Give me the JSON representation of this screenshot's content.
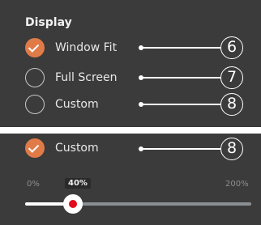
{
  "display": {
    "heading": "Display",
    "options": [
      {
        "label": "Window Fit",
        "selected": true,
        "callout": "6"
      },
      {
        "label": "Full Screen",
        "selected": false,
        "callout": "7"
      },
      {
        "label": "Custom",
        "selected": false,
        "callout": "8"
      }
    ]
  },
  "custom_detail": {
    "option": {
      "label": "Custom",
      "selected": true,
      "callout": "8"
    },
    "slider": {
      "min_label": "0%",
      "max_label": "200%",
      "value_label": "40%",
      "value_percent": 40,
      "min": 0,
      "max": 200
    }
  },
  "colors": {
    "panel": "#3b3b3b",
    "accent": "#e07b48",
    "thumb_center": "#e30b1e"
  }
}
